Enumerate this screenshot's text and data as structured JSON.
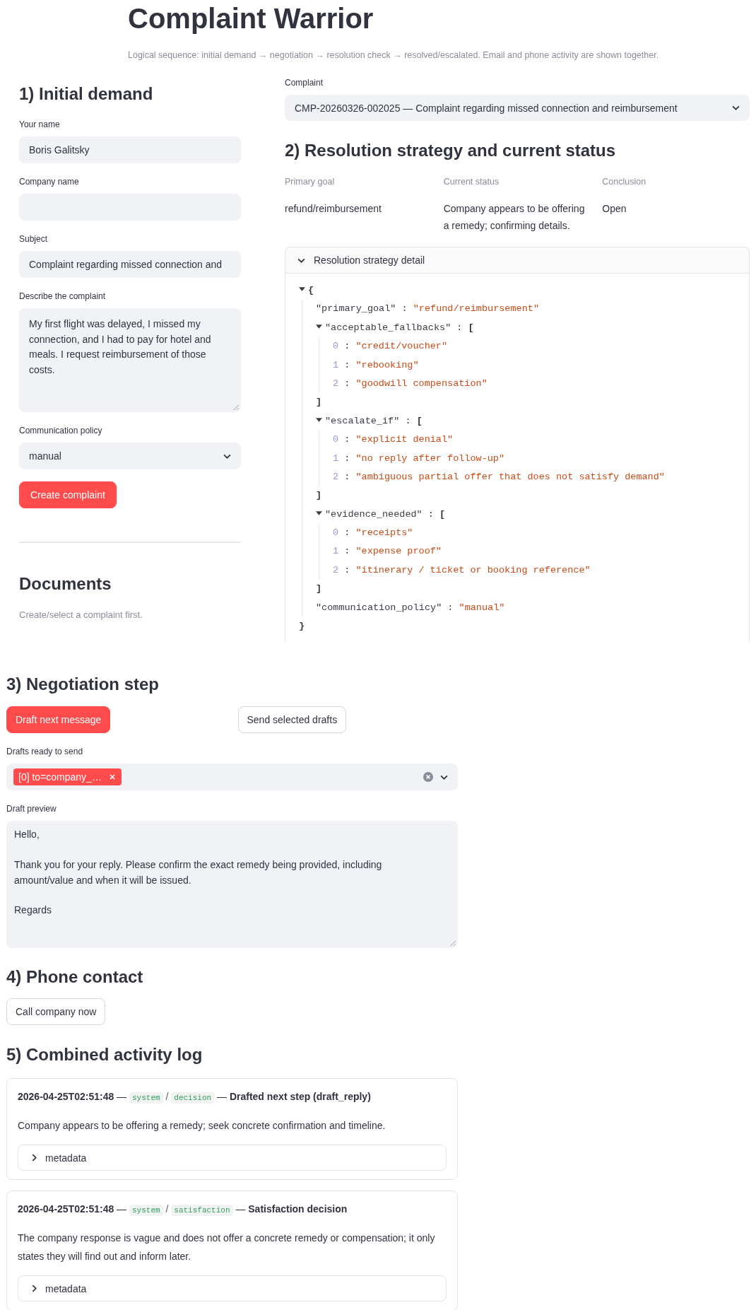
{
  "header": {
    "title": "Complaint Warrior",
    "subtitle": "Logical sequence: initial demand → negotiation → resolution check → resolved/escalated. Email and phone activity are shown together."
  },
  "initial_demand": {
    "heading": "1) Initial demand",
    "fields": [
      {
        "kind": "input",
        "label": "Your name",
        "value": "Boris Galitsky"
      },
      {
        "kind": "input",
        "label": "Company name"
      },
      {
        "kind": "input",
        "label": "Subject",
        "value": "Complaint regarding missed connection and"
      },
      {
        "kind": "textarea",
        "label": "Describe the complaint",
        "value": "My first flight was delayed, I missed my connection, and I had to pay for hotel and meals. I request reimbursement of those costs."
      },
      {
        "kind": "select",
        "label": "Communication policy",
        "value": "manual"
      }
    ],
    "button": {
      "label": "Create complaint",
      "kind": "primary"
    }
  },
  "documents": {
    "heading": "Documents",
    "note": "Create/select a complaint first."
  },
  "complaint": {
    "label": "Complaint",
    "value": "CMP-20260326-002025 — Complaint regarding missed connection and reimbursement"
  },
  "strategy": {
    "heading": "2) Resolution strategy and current status",
    "metrics": [
      {
        "label": "Primary goal",
        "value": "refund/reimbursement"
      },
      {
        "label": "Current status",
        "value": "Company appears to be offering a remedy; confirming details."
      },
      {
        "label": "Conclusion",
        "value": "Open"
      }
    ],
    "detail": {
      "title": "Resolution strategy detail",
      "expanded": true,
      "tree": {
        "kind": "object",
        "open": "{",
        "close": "}",
        "expanded": true,
        "children": [
          {
            "kind": "string",
            "key": "\"primary_goal\"",
            "sep": ":",
            "value": "\"refund/reimbursement\""
          },
          {
            "kind": "array",
            "key": "\"acceptable_fallbacks\"",
            "sep": ":",
            "open": "[",
            "close": "]",
            "expanded": true,
            "children": [
              {
                "kind": "string",
                "key": "0",
                "sep": ":",
                "value": "\"credit/voucher\""
              },
              {
                "kind": "string",
                "key": "1",
                "sep": ":",
                "value": "\"rebooking\""
              },
              {
                "kind": "string",
                "key": "2",
                "sep": ":",
                "value": "\"goodwill compensation\""
              }
            ]
          },
          {
            "kind": "array",
            "key": "\"escalate_if\"",
            "sep": ":",
            "open": "[",
            "close": "]",
            "expanded": true,
            "children": [
              {
                "kind": "string",
                "key": "0",
                "sep": ":",
                "value": "\"explicit denial\""
              },
              {
                "kind": "string",
                "key": "1",
                "sep": ":",
                "value": "\"no reply after follow-up\""
              },
              {
                "kind": "string",
                "key": "2",
                "sep": ":",
                "value": "\"ambiguous partial offer that does not satisfy demand\""
              }
            ]
          },
          {
            "kind": "array",
            "key": "\"evidence_needed\"",
            "sep": ":",
            "open": "[",
            "close": "]",
            "expanded": true,
            "children": [
              {
                "kind": "string",
                "key": "0",
                "sep": ":",
                "value": "\"receipts\""
              },
              {
                "kind": "string",
                "key": "1",
                "sep": ":",
                "value": "\"expense proof\""
              },
              {
                "kind": "string",
                "key": "2",
                "sep": ":",
                "value": "\"itinerary / ticket or booking reference\""
              }
            ]
          },
          {
            "kind": "string",
            "key": "\"communication_policy\"",
            "sep": ":",
            "value": "\"manual\""
          }
        ]
      }
    }
  },
  "negotiation": {
    "heading": "3) Negotiation step",
    "buttons": [
      {
        "label": "Draft next message",
        "kind": "primary"
      },
      {
        "label": "Send selected drafts",
        "kind": "secondary"
      }
    ],
    "drafts": {
      "label": "Drafts ready to send",
      "tags": [
        {
          "label": "[0] to=company_…"
        }
      ]
    },
    "preview": {
      "label": "Draft preview",
      "value": "Hello,\n\nThank you for your reply. Please confirm the exact remedy being provided, including amount/value and when it will be issued.\n\nRegards"
    }
  },
  "phone": {
    "heading": "4) Phone contact",
    "button": {
      "label": "Call company now",
      "kind": "secondary"
    }
  },
  "activity_log": {
    "heading": "5) Combined activity log",
    "entries": [
      {
        "lead": "**2026-04-25T02:51:48** —",
        "source": "system",
        "sep": "/",
        "category": "decision",
        "tail": "— **Drafted next step (draft_reply)**",
        "text": "Company appears to be offering a remedy; seek concrete confirmation and timeline.",
        "metadata": {
          "title": "metadata",
          "expanded": false
        }
      },
      {
        "lead": "**2026-04-25T02:51:48** —",
        "source": "system",
        "sep": "/",
        "category": "satisfaction",
        "tail": "— **Satisfaction decision**",
        "text": "The company response is vague and does not offer a concrete remedy or compensation; it only states they will find out and inform later.",
        "metadata": {
          "title": "metadata",
          "expanded": false
        }
      }
    ]
  }
}
